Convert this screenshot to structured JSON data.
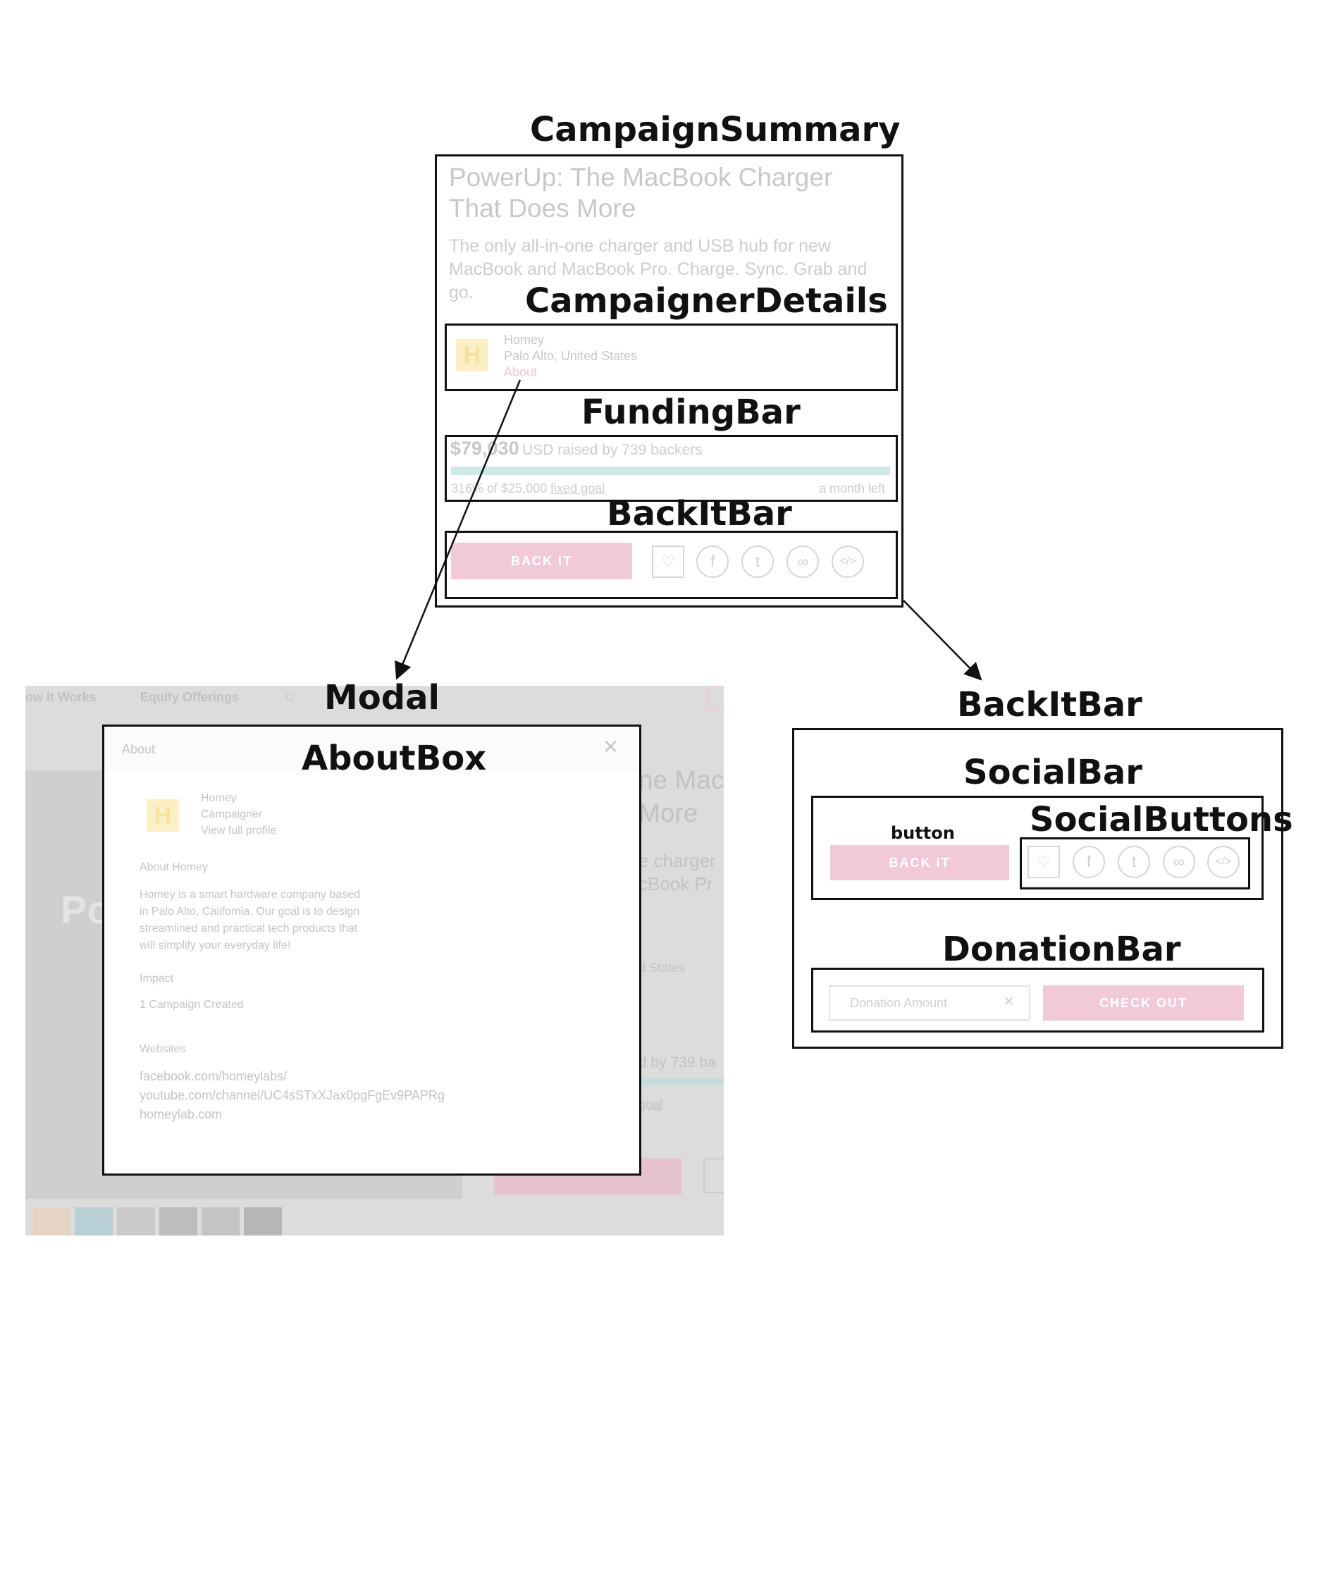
{
  "labels": {
    "campaign_summary": "CampaignSummary",
    "campaigner_details": "CampaignerDetails",
    "funding_bar": "FundingBar",
    "backit_bar": "BackItBar",
    "modal": "Modal",
    "about_box": "AboutBox",
    "backit_bar_detail": "BackItBar",
    "social_bar": "SocialBar",
    "button": "button",
    "social_buttons": "SocialButtons",
    "donation_bar": "DonationBar"
  },
  "summary": {
    "title_line1": "PowerUp: The MacBook Charger",
    "title_line2": "That Does More",
    "desc_line1": "The only all-in-one charger and USB hub for new",
    "desc_line2": "MacBook and MacBook Pro. Charge. Sync. Grab and",
    "desc_line3": "go.",
    "campaigner_name": "Homey",
    "campaigner_location": "Palo Alto, United States",
    "campaigner_about": "About",
    "logo_letter": "H",
    "amount": "$79,030",
    "raised_text": "USD raised by 739 backers",
    "percent_text": "316% of $25,000",
    "goal_link": "fixed goal",
    "time_left": "a month left",
    "funded_fraction": 1.0,
    "back_it_label": "BACK IT"
  },
  "modal": {
    "nav_how": "ow It Works",
    "nav_equity": "Equity Offerings",
    "header_title": "About",
    "close_glyph": "×",
    "profile_name": "Homey",
    "profile_role": "Campaigner",
    "profile_link": "View full profile",
    "about_heading": "About Homey",
    "about_line1": "Homey is a smart hardware company based",
    "about_line2": "in Palo Alto, California. Our goal is to design",
    "about_line3": "streamlined and practical tech products that",
    "about_line4": "will simplify your everyday life!",
    "impact_heading": "Impact",
    "impact_value": "1 Campaign Created",
    "websites_heading": "Websites",
    "websites": [
      "facebook.com/homeylabs/",
      "youtube.com/channel/UC4sSTxXJax0pgFgEv9PAPRg",
      "homeylab.com"
    ],
    "bg_title_1": "ne Mac",
    "bg_title_2": "More",
    "bg_desc_1": "e charger",
    "bg_desc_2": "cBook Pr",
    "bg_location": "d States",
    "bg_backers": "d by 739 ba",
    "bg_goal": "goal",
    "bg_hero": "Po"
  },
  "detail": {
    "back_it_label": "BACK IT",
    "donation_placeholder": "Donation Amount",
    "clear_glyph": "×",
    "checkout_label": "CHECK OUT"
  },
  "colors": {
    "accent_pink": "#f2c9d8",
    "progress_teal": "#cfe9e9",
    "logo_yellow": "#fbf0c5"
  }
}
